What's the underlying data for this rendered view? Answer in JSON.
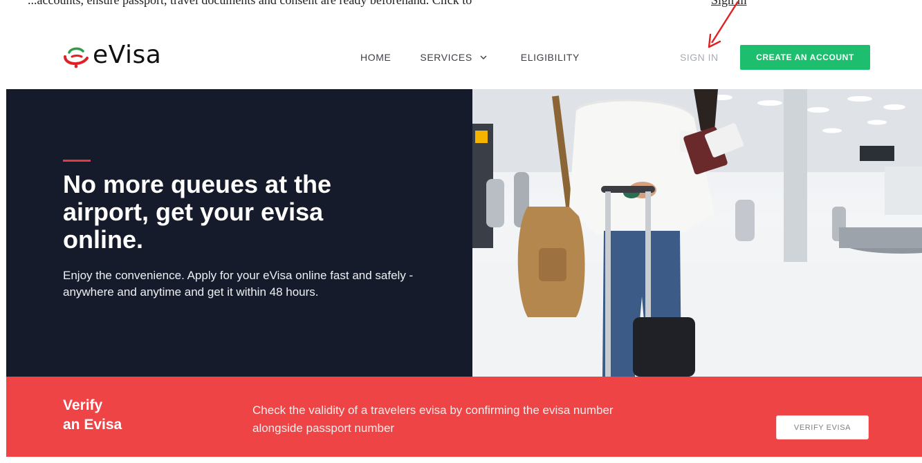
{
  "doc_strip": {
    "line": "...accounts, ensure passport, travel documents and consent are ready beforehand. Click to",
    "link": "Sign in"
  },
  "header": {
    "logo_text": "eVisa",
    "nav": {
      "home": "HOME",
      "services": "SERVICES",
      "eligibility": "ELIGIBILITY"
    },
    "sign_in": "SIGN IN",
    "create_account": "CREATE AN ACCOUNT"
  },
  "hero": {
    "title": "No more queues at the airport, get your evisa online.",
    "subtitle": "Enjoy the convenience. Apply for your eVisa online fast and safely - anywhere and anytime and get it within 48 hours."
  },
  "verify": {
    "title_line1": "Verify",
    "title_line2": "an Evisa",
    "description": "Check the validity of a travelers evisa by confirming the evisa number alongside passport number",
    "button": "VERIFY EVISA"
  },
  "colors": {
    "hero_dark": "#151b2b",
    "accent_red": "#e63a3d",
    "verify_band": "#ef4446",
    "create_green": "#1dbf6e",
    "annotation_arrow": "#e02020"
  },
  "icons": {
    "logo": "evisa-logo-mark",
    "services_dropdown": "chevron-down-icon",
    "annotation": "red-arrow-icon"
  }
}
